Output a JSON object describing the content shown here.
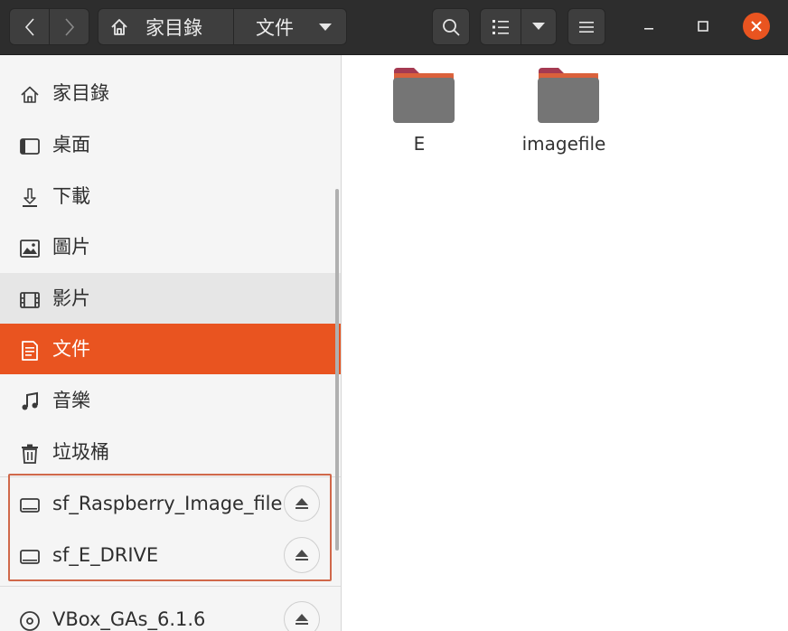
{
  "header": {
    "path": [
      {
        "label": "家目錄",
        "icon": "home-icon"
      },
      {
        "label": "文件",
        "icon": "chevron-down-icon"
      }
    ]
  },
  "sidebar": {
    "items": [
      {
        "label": "家目錄",
        "icon": "home-icon"
      },
      {
        "label": "桌面",
        "icon": "desktop-icon"
      },
      {
        "label": "下載",
        "icon": "download-icon"
      },
      {
        "label": "圖片",
        "icon": "pictures-icon"
      },
      {
        "label": "影片",
        "icon": "videos-icon"
      },
      {
        "label": "文件",
        "icon": "documents-icon",
        "active": true
      },
      {
        "label": "音樂",
        "icon": "music-icon"
      },
      {
        "label": "垃圾桶",
        "icon": "trash-icon"
      }
    ],
    "mounts": [
      {
        "label": "sf_Raspberry_Image_file",
        "icon": "drive-icon"
      },
      {
        "label": "sf_E_DRIVE",
        "icon": "drive-icon"
      },
      {
        "label": "VBox_GAs_6.1.6",
        "icon": "disc-icon"
      }
    ]
  },
  "main": {
    "files": [
      {
        "name": "E",
        "icon": "folder-icon"
      },
      {
        "name": "imagefile",
        "icon": "folder-icon"
      }
    ]
  },
  "colors": {
    "accent": "#e95420",
    "highlight_box": "#d0684a",
    "folder_top": "#a53a52",
    "folder_body": "#757575"
  }
}
